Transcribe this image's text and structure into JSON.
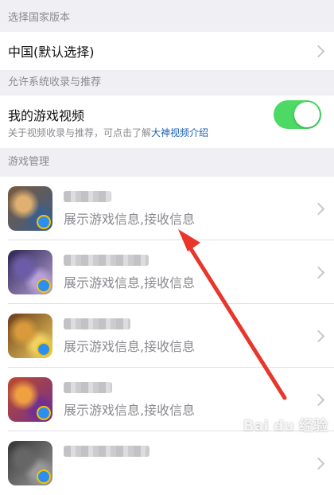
{
  "sections": {
    "country_header": "选择国家版本",
    "country_value": "中国(默认选择)",
    "recommend_header": "允许系统收录与推荐",
    "video_title": "我的游戏视频",
    "video_sub_prefix": "关于视频收录与推荐，可点击了解",
    "video_sub_link": "大神视频介绍",
    "video_toggle_on": true,
    "games_header": "游戏管理"
  },
  "games": [
    {
      "desc": "展示游戏信息,接收信息",
      "icon_colors": [
        "#7a5a3a",
        "#e0b070",
        "#3b5e8c"
      ]
    },
    {
      "desc": "展示游戏信息,接收信息",
      "icon_colors": [
        "#2a2350",
        "#6b5ca8",
        "#b7a1d8"
      ]
    },
    {
      "desc": "展示游戏信息,接收信息",
      "icon_colors": [
        "#6a3a1a",
        "#d89a3a",
        "#f0d060"
      ]
    },
    {
      "desc": "展示游戏信息,接收信息",
      "icon_colors": [
        "#c04a2a",
        "#f0a040",
        "#703090"
      ]
    },
    {
      "desc": "",
      "icon_colors": [
        "#333333",
        "#666666",
        "#999999"
      ]
    }
  ],
  "watermark": "Bai du 经验",
  "colors": {
    "toggle_on": "#4cd964",
    "link": "#1a5fb4",
    "arrow": "#e8362b"
  }
}
